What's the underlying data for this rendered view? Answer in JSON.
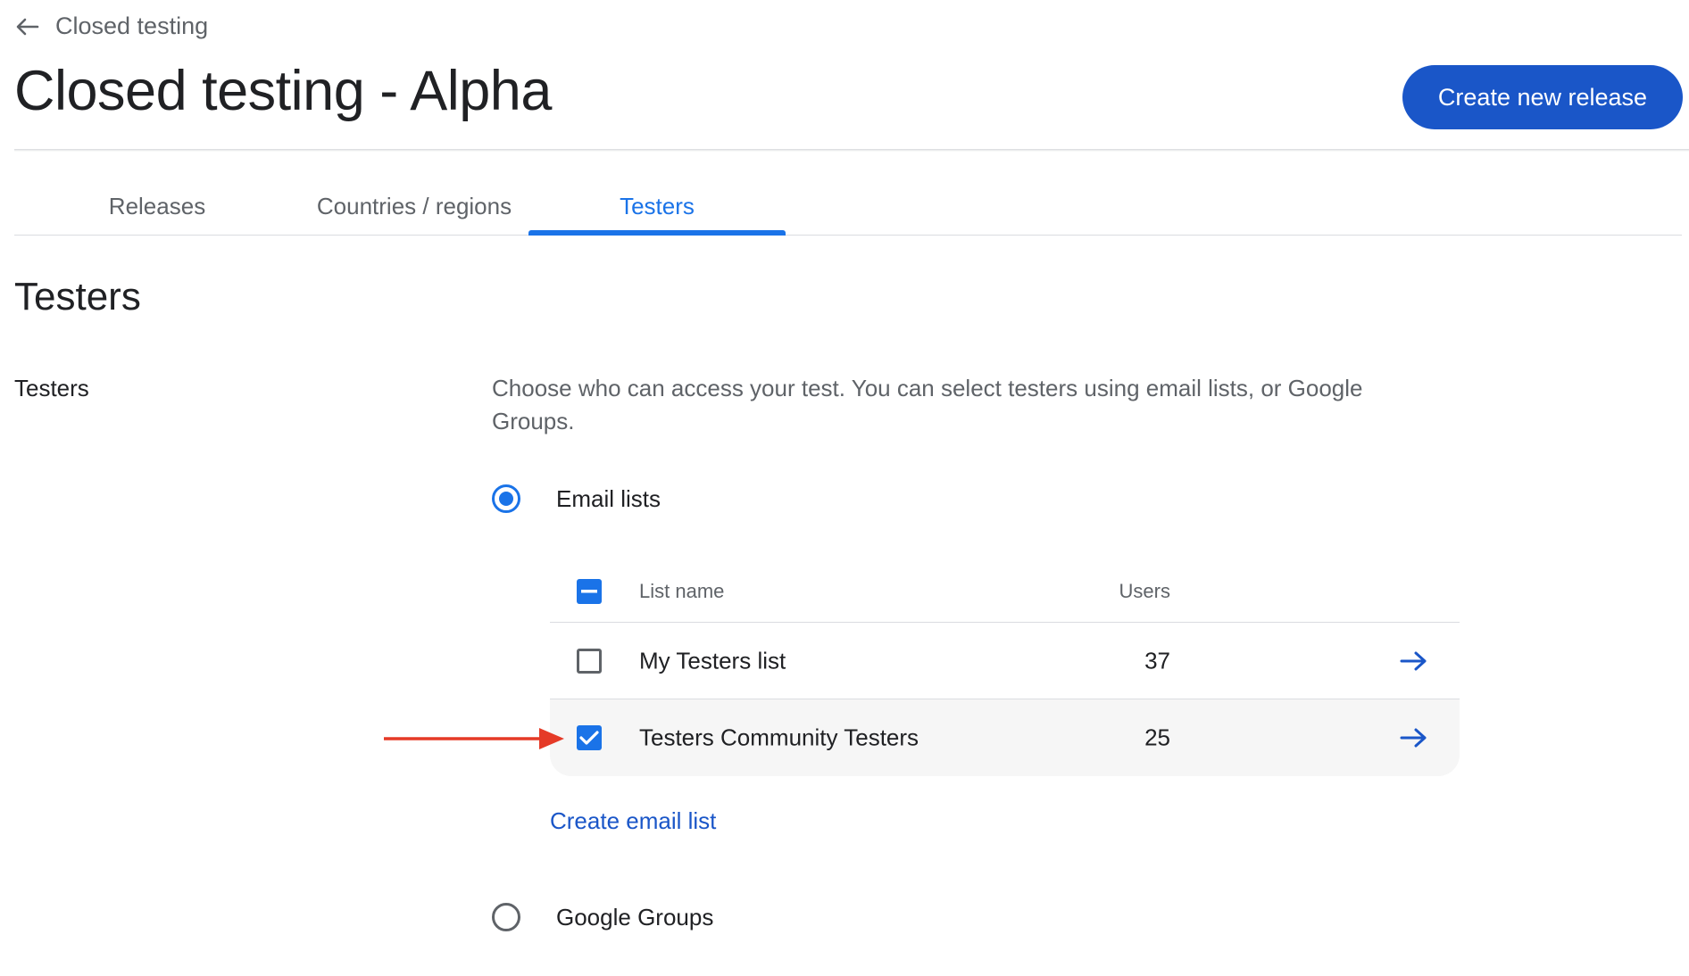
{
  "header": {
    "back_label": "Closed testing",
    "title": "Closed testing - Alpha",
    "create_release_label": "Create new release"
  },
  "tabs": [
    {
      "label": "Releases",
      "active": false
    },
    {
      "label": "Countries / regions",
      "active": false
    },
    {
      "label": "Testers",
      "active": true
    }
  ],
  "section": {
    "heading": "Testers",
    "row_label": "Testers",
    "description": "Choose who can access your test. You can select testers using email lists, or Google Groups."
  },
  "options": {
    "email_lists": {
      "label": "Email lists",
      "selected": true
    },
    "google_groups": {
      "label": "Google Groups",
      "selected": false
    }
  },
  "table": {
    "columns": {
      "list_name": "List name",
      "users": "Users"
    },
    "header_checkbox_state": "indeterminate",
    "rows": [
      {
        "name": "My Testers list",
        "users": "37",
        "checked": false
      },
      {
        "name": "Testers Community Testers",
        "users": "25",
        "checked": true
      }
    ]
  },
  "create_email_list_label": "Create email list",
  "icons": {
    "back": "arrow-left-icon",
    "row_link": "arrow-right-icon",
    "annotation": "red-pointer-arrow"
  },
  "colors": {
    "primary_button": "#1a56c8",
    "accent": "#1a73e8",
    "annotation": "#e53a27",
    "selected_row": "#f6f6f6"
  }
}
